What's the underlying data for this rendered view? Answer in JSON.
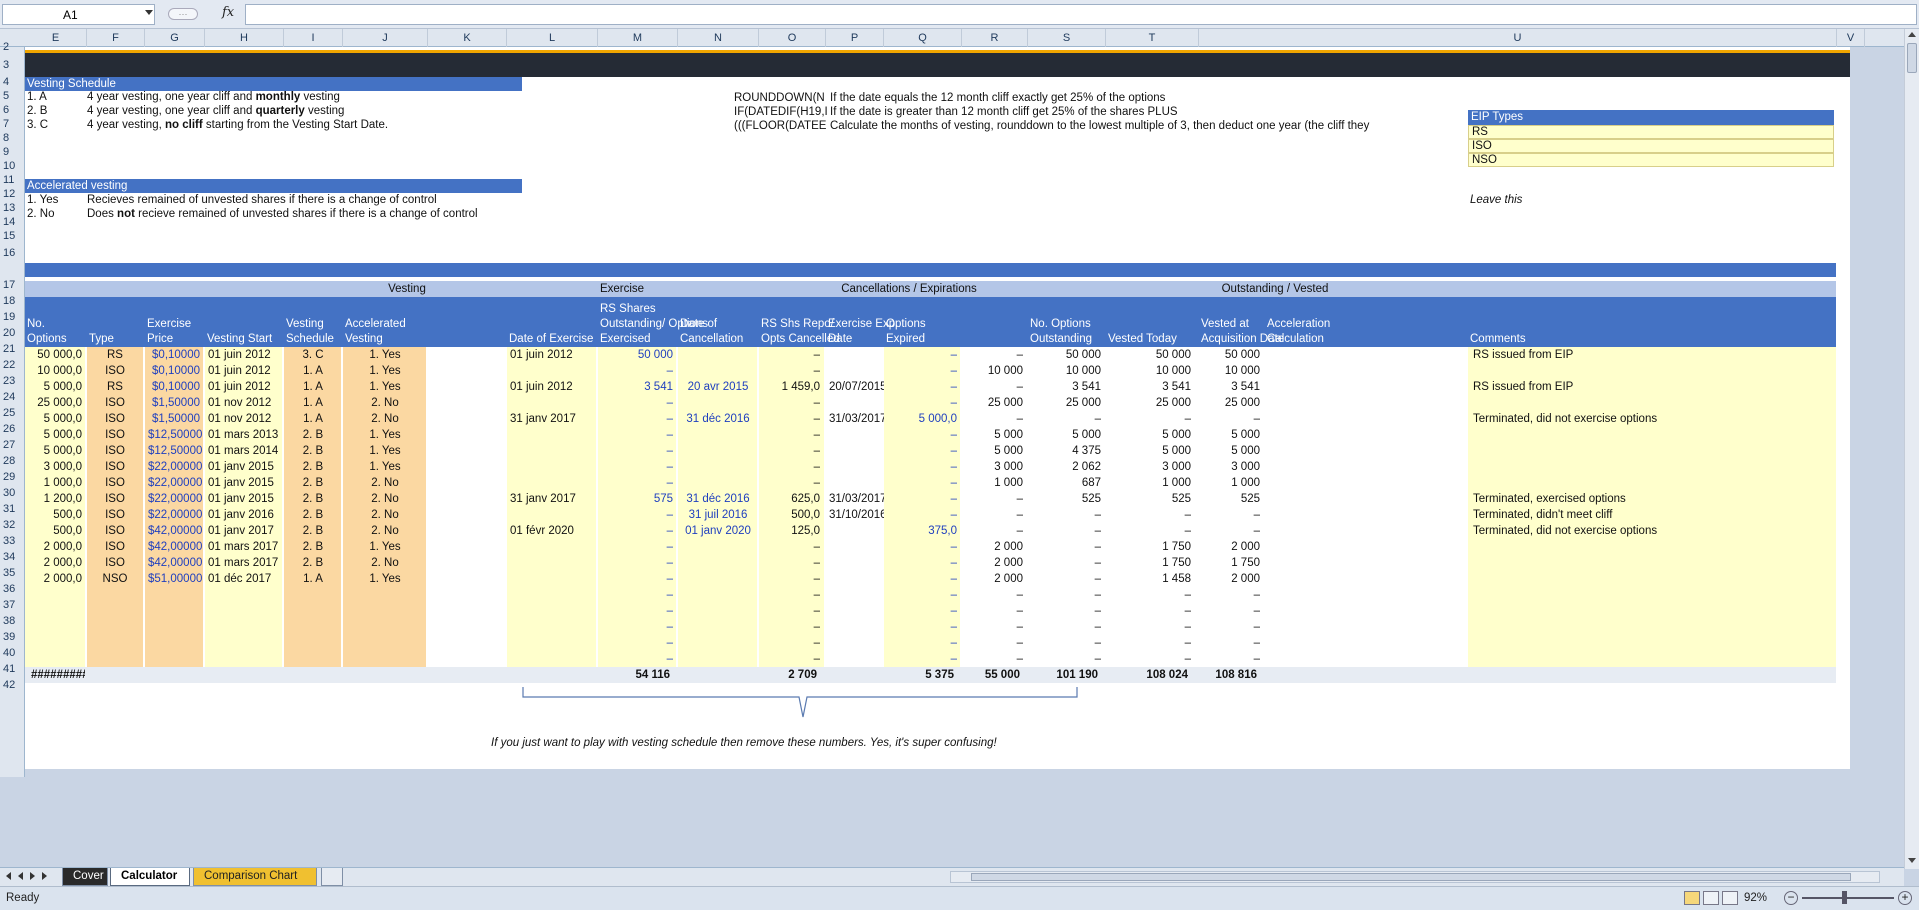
{
  "formula_bar": {
    "cell_ref": "A1",
    "fx": "fx",
    "formula": ""
  },
  "columns": [
    {
      "l": "E"
    },
    {
      "l": "F"
    },
    {
      "l": "G"
    },
    {
      "l": "H"
    },
    {
      "l": "I"
    },
    {
      "l": "J"
    },
    {
      "l": "K"
    },
    {
      "l": "L"
    },
    {
      "l": "M"
    },
    {
      "l": "N"
    },
    {
      "l": "O"
    },
    {
      "l": "P"
    },
    {
      "l": "Q"
    },
    {
      "l": "R"
    },
    {
      "l": "S"
    },
    {
      "l": "T"
    },
    {
      "l": "U"
    },
    {
      "l": "V"
    }
  ],
  "rows": [
    "2",
    "3",
    "4",
    "5",
    "6",
    "7",
    "8",
    "9",
    "10",
    "11",
    "12",
    "13",
    "14",
    "15",
    "16",
    "17",
    "18",
    "19",
    "20",
    "21",
    "22",
    "23",
    "24",
    "25",
    "26",
    "27",
    "28",
    "29",
    "30",
    "31",
    "32",
    "33",
    "34",
    "35",
    "36",
    "37",
    "38",
    "39",
    "40",
    "41",
    "42"
  ],
  "vesting_schedule": {
    "title": "Vesting Schedule",
    "items": [
      {
        "code": "1. A",
        "pre": "4 year vesting, one year cliff and ",
        "bold": "monthly",
        "post": " vesting"
      },
      {
        "code": "2. B",
        "pre": "4 year vesting, one year cliff and ",
        "bold": "quarterly",
        "post": " vesting"
      },
      {
        "code": "3. C",
        "pre": "4 year vesting, ",
        "bold": "no cliff",
        "post": " starting from the Vesting Start Date."
      }
    ]
  },
  "accelerated_vesting": {
    "title": "Accelerated vesting",
    "items": [
      {
        "code": "1. Yes",
        "pre": "Recieves remained of unvested shares if there is a change of control",
        "bold": "",
        "post": ""
      },
      {
        "code": "2. No",
        "pre": "Does ",
        "bold": "not",
        "post": " recieve remained of unvested shares if there is a change of control"
      }
    ]
  },
  "formulas": [
    {
      "f": "ROUNDDOWN(N",
      "note": "If the date equals the 12 month cliff exactly get 25% of the options"
    },
    {
      "f": "IF(DATEDIF(H19,I",
      "note": "If the date is greater than 12 month cliff get 25% of the shares PLUS"
    },
    {
      "f": "(((FLOOR(DATEE",
      "note": "Calculate the months of vesting, rounddown to the lowest multiple of 3, then deduct one year (the cliff they"
    }
  ],
  "eip_types": {
    "title": "EIP Types",
    "items": [
      "RS",
      "ISO",
      "NSO"
    ],
    "leave": "Leave this"
  },
  "groups": {
    "vesting": "Vesting",
    "exercise": "Exercise",
    "cancel": "Cancellations / Expirations",
    "outstanding": "Outstanding / Vested"
  },
  "headers": {
    "no_options": "No. Options",
    "type": "Type",
    "exercise_price": "Exercise Price",
    "vesting_start": "Vesting Start",
    "vesting_schedule": "Vesting Schedule",
    "accelerated": "Accelerated Vesting",
    "date_exercise": "Date of Exercise",
    "rs_shares": "RS Shares Outstanding/ Options Exercised",
    "date_cancel": "Date of Cancellation",
    "rs_repo": "RS Shs Repo/ Opts Cancelled",
    "exercise_exp": "Exercise Exp. Date",
    "options_expired": "Options Expired",
    "options_outstanding": "No. Options Outstanding",
    "vested_today": "Vested Today",
    "vested_acq": "Vested at Acquisition Date",
    "accel_calc": "Acceleration Calculation",
    "comments": "Comments"
  },
  "data": [
    {
      "e": "50 000,0",
      "f": "RS",
      "g": "$0,10000",
      "h": "01 juin 2012",
      "i": "3. C",
      "j": "1. Yes",
      "k": "01 juin 2012",
      "l": "50 000",
      "m": "",
      "n": "–",
      "o": "",
      "p": "–",
      "q": "–",
      "r": "50 000",
      "s": "50 000",
      "t": "50 000",
      "u": "RS issued from EIP"
    },
    {
      "e": "10 000,0",
      "f": "ISO",
      "g": "$0,10000",
      "h": "01 juin 2012",
      "i": "1. A",
      "j": "1. Yes",
      "k": "",
      "l": "–",
      "m": "",
      "n": "–",
      "o": "",
      "p": "–",
      "q": "10 000",
      "r": "10 000",
      "s": "10 000",
      "t": "10 000",
      "u": ""
    },
    {
      "e": "5 000,0",
      "f": "RS",
      "g": "$0,10000",
      "h": "01 juin 2012",
      "i": "1. A",
      "j": "1. Yes",
      "k": "01 juin 2012",
      "l": "3 541",
      "m": "20 avr 2015",
      "n": "1 459,0",
      "o": "20/07/2015",
      "p": "–",
      "q": "–",
      "r": "3 541",
      "s": "3 541",
      "t": "3 541",
      "u": "RS issued from EIP"
    },
    {
      "e": "25 000,0",
      "f": "ISO",
      "g": "$1,50000",
      "h": "01 nov 2012",
      "i": "1. A",
      "j": "2. No",
      "k": "",
      "l": "–",
      "m": "",
      "n": "–",
      "o": "",
      "p": "–",
      "q": "25 000",
      "r": "25 000",
      "s": "25 000",
      "t": "25 000",
      "u": ""
    },
    {
      "e": "5 000,0",
      "f": "ISO",
      "g": "$1,50000",
      "h": "01 nov 2012",
      "i": "1. A",
      "j": "2. No",
      "k": "31 janv 2017",
      "l": "–",
      "m": "31 déc 2016",
      "n": "–",
      "o": "31/03/2017",
      "p": "5 000,0",
      "q": "–",
      "r": "–",
      "s": "–",
      "t": "–",
      "u": "Terminated, did not exercise options"
    },
    {
      "e": "5 000,0",
      "f": "ISO",
      "g": "$12,50000",
      "h": "01 mars 2013",
      "i": "2. B",
      "j": "1. Yes",
      "k": "",
      "l": "–",
      "m": "",
      "n": "–",
      "o": "",
      "p": "–",
      "q": "5 000",
      "r": "5 000",
      "s": "5 000",
      "t": "5 000",
      "u": ""
    },
    {
      "e": "5 000,0",
      "f": "ISO",
      "g": "$12,50000",
      "h": "01 mars 2014",
      "i": "2. B",
      "j": "1. Yes",
      "k": "",
      "l": "–",
      "m": "",
      "n": "–",
      "o": "",
      "p": "–",
      "q": "5 000",
      "r": "4 375",
      "s": "5 000",
      "t": "5 000",
      "u": ""
    },
    {
      "e": "3 000,0",
      "f": "ISO",
      "g": "$22,00000",
      "h": "01 janv 2015",
      "i": "2. B",
      "j": "1. Yes",
      "k": "",
      "l": "–",
      "m": "",
      "n": "–",
      "o": "",
      "p": "–",
      "q": "3 000",
      "r": "2 062",
      "s": "3 000",
      "t": "3 000",
      "u": ""
    },
    {
      "e": "1 000,0",
      "f": "ISO",
      "g": "$22,00000",
      "h": "01 janv 2015",
      "i": "2. B",
      "j": "2. No",
      "k": "",
      "l": "–",
      "m": "",
      "n": "–",
      "o": "",
      "p": "–",
      "q": "1 000",
      "r": "687",
      "s": "1 000",
      "t": "1 000",
      "u": ""
    },
    {
      "e": "1 200,0",
      "f": "ISO",
      "g": "$22,00000",
      "h": "01 janv 2015",
      "i": "2. B",
      "j": "2. No",
      "k": "31 janv 2017",
      "l": "575",
      "m": "31 déc 2016",
      "n": "625,0",
      "o": "31/03/2017",
      "p": "–",
      "q": "–",
      "r": "525",
      "s": "525",
      "t": "525",
      "u": "Terminated, exercised options"
    },
    {
      "e": "500,0",
      "f": "ISO",
      "g": "$22,00000",
      "h": "01 janv 2016",
      "i": "2. B",
      "j": "2. No",
      "k": "",
      "l": "–",
      "m": "31 juil 2016",
      "n": "500,0",
      "o": "31/10/2016",
      "p": "–",
      "q": "–",
      "r": "–",
      "s": "–",
      "t": "–",
      "u": "Terminated, didn't meet cliff"
    },
    {
      "e": "500,0",
      "f": "ISO",
      "g": "$42,00000",
      "h": "01 janv 2017",
      "i": "2. B",
      "j": "2. No",
      "k": "01 févr 2020",
      "l": "–",
      "m": "01 janv 2020",
      "n": "125,0",
      "o": "",
      "p": "375,0",
      "q": "–",
      "r": "–",
      "s": "–",
      "t": "–",
      "u": "Terminated, did not exercise options"
    },
    {
      "e": "2 000,0",
      "f": "ISO",
      "g": "$42,00000",
      "h": "01 mars 2017",
      "i": "2. B",
      "j": "1. Yes",
      "k": "",
      "l": "–",
      "m": "",
      "n": "–",
      "o": "",
      "p": "–",
      "q": "2 000",
      "r": "–",
      "s": "1 750",
      "t": "2 000",
      "u": ""
    },
    {
      "e": "2 000,0",
      "f": "ISO",
      "g": "$42,00000",
      "h": "01 mars 2017",
      "i": "2. B",
      "j": "2. No",
      "k": "",
      "l": "–",
      "m": "",
      "n": "–",
      "o": "",
      "p": "–",
      "q": "2 000",
      "r": "–",
      "s": "1 750",
      "t": "1 750",
      "u": ""
    },
    {
      "e": "2 000,0",
      "f": "NSO",
      "g": "$51,00000",
      "h": "01 déc 2017",
      "i": "1. A",
      "j": "1. Yes",
      "k": "",
      "l": "–",
      "m": "",
      "n": "–",
      "o": "",
      "p": "–",
      "q": "2 000",
      "r": "–",
      "s": "1 458",
      "t": "2 000",
      "u": ""
    },
    {
      "e": "",
      "f": "",
      "g": "",
      "h": "",
      "i": "",
      "j": "",
      "k": "",
      "l": "–",
      "m": "",
      "n": "–",
      "o": "",
      "p": "–",
      "q": "–",
      "r": "–",
      "s": "–",
      "t": "–",
      "u": ""
    },
    {
      "e": "",
      "f": "",
      "g": "",
      "h": "",
      "i": "",
      "j": "",
      "k": "",
      "l": "–",
      "m": "",
      "n": "–",
      "o": "",
      "p": "–",
      "q": "–",
      "r": "–",
      "s": "–",
      "t": "–",
      "u": ""
    },
    {
      "e": "",
      "f": "",
      "g": "",
      "h": "",
      "i": "",
      "j": "",
      "k": "",
      "l": "–",
      "m": "",
      "n": "–",
      "o": "",
      "p": "–",
      "q": "–",
      "r": "–",
      "s": "–",
      "t": "–",
      "u": ""
    },
    {
      "e": "",
      "f": "",
      "g": "",
      "h": "",
      "i": "",
      "j": "",
      "k": "",
      "l": "–",
      "m": "",
      "n": "–",
      "o": "",
      "p": "–",
      "q": "–",
      "r": "–",
      "s": "–",
      "t": "–",
      "u": ""
    },
    {
      "e": "",
      "f": "",
      "g": "",
      "h": "",
      "i": "",
      "j": "",
      "k": "",
      "l": "–",
      "m": "",
      "n": "–",
      "o": "",
      "p": "–",
      "q": "–",
      "r": "–",
      "s": "–",
      "t": "–",
      "u": ""
    }
  ],
  "totals": {
    "e": "#########",
    "l": "54 116",
    "n": "2 709",
    "p": "5 375",
    "q": "55 000",
    "r": "101 190",
    "s": "108 024",
    "t": "108 816"
  },
  "note": "If you just want to play with vesting schedule then remove these numbers. Yes, it's super confusing!",
  "tabs": {
    "cover": "Cover",
    "calculator": "Calculator",
    "chart": "Comparison Chart"
  },
  "status": {
    "ready": "Ready",
    "zoom": "92%"
  }
}
